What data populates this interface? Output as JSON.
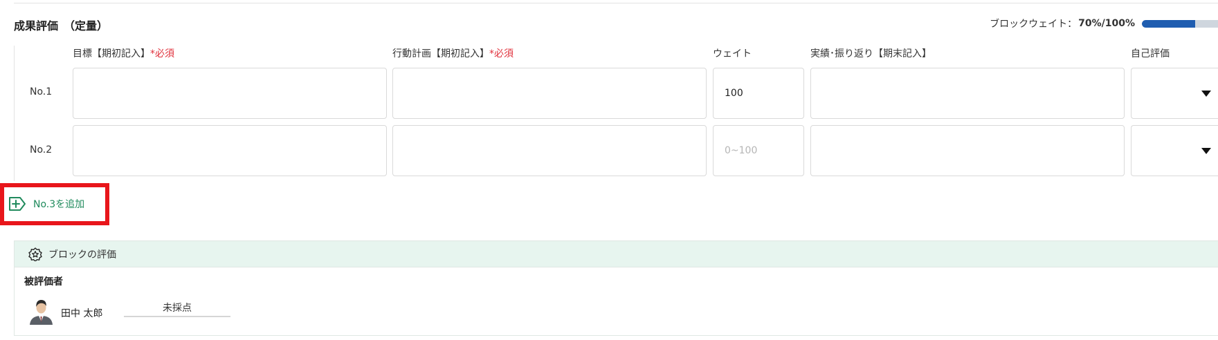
{
  "section": {
    "title": "成果評価　（定量）",
    "block_weight_label": "ブロックウェイト：",
    "block_weight_value": "70%/100%",
    "block_weight_progress": 0.7,
    "bar_fill_color": "#1f5db0",
    "bar_track_color": "#cfd6de"
  },
  "columns": {
    "goal": {
      "label": "目標【期初記入】",
      "required": "*必須"
    },
    "action_plan": {
      "label": "行動計画【期初記入】",
      "required": "*必須"
    },
    "weight": {
      "label": "ウェイト"
    },
    "results": {
      "label": "実績･振り返り【期末記入】"
    },
    "self_eval": {
      "label": "自己評価"
    }
  },
  "rows": [
    {
      "label": "No.1",
      "weight_value": "100",
      "weight_placeholder": "",
      "unit": "%"
    },
    {
      "label": "No.2",
      "weight_value": "",
      "weight_placeholder": "0~100",
      "unit": "%"
    }
  ],
  "add_button": {
    "label": "No.3を追加",
    "icon": "add-tag-icon",
    "color": "#1f8a5c",
    "highlight_color": "#e8161b"
  },
  "evaluation": {
    "header": "ブロックの評価",
    "header_icon": "star-badge-icon",
    "header_bg": "#e7f5ef",
    "evaluee_label": "被評価者",
    "evaluee_name": "田中 太郎",
    "status": "未採点"
  }
}
